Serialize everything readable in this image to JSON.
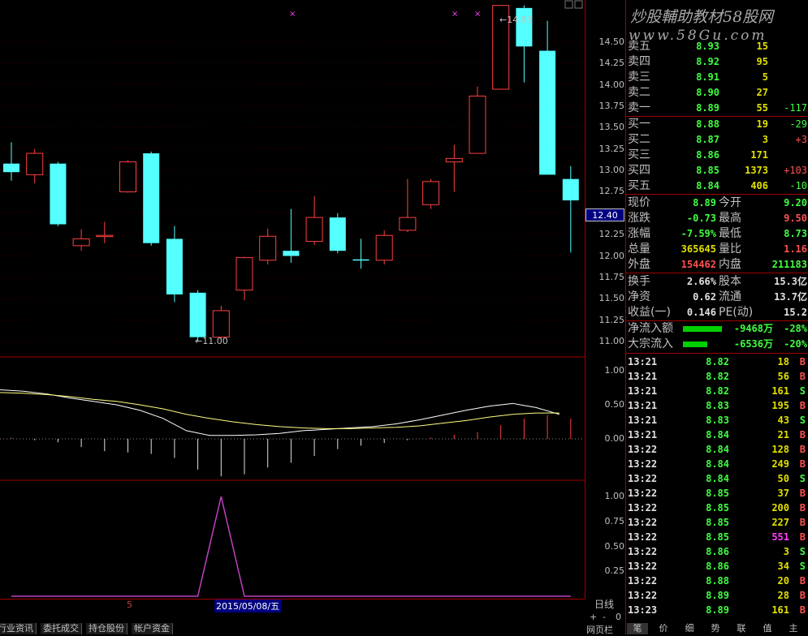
{
  "chart": {
    "price_ticks": [
      "14.50",
      "14.25",
      "14.00",
      "13.75",
      "13.50",
      "13.25",
      "13.00",
      "12.75",
      "12.50",
      "12.25",
      "12.00",
      "11.75",
      "11.50",
      "11.25",
      "11.00"
    ],
    "current_price_marker": "12.40",
    "high_label": "14.93",
    "low_label": "11.00",
    "macd_ticks": [
      "1.00",
      "0.50",
      "0.00"
    ],
    "ind_ticks": [
      "1.00",
      "0.75",
      "0.50",
      "0.25"
    ],
    "date_label": "2015/05/08/五",
    "left_marker": "5",
    "period_label": "日线",
    "candles": [
      {
        "o": 13.08,
        "c": 12.98,
        "h": 13.33,
        "l": 12.88
      },
      {
        "o": 12.95,
        "c": 13.2,
        "h": 13.25,
        "l": 12.85
      },
      {
        "o": 13.08,
        "c": 12.37,
        "h": 13.1,
        "l": 12.35
      },
      {
        "o": 12.12,
        "c": 12.2,
        "h": 12.31,
        "l": 12.06
      },
      {
        "o": 12.24,
        "c": 12.24,
        "h": 12.4,
        "l": 12.15
      },
      {
        "o": 12.75,
        "c": 13.1,
        "h": 13.12,
        "l": 12.74
      },
      {
        "o": 13.2,
        "c": 12.15,
        "h": 13.22,
        "l": 12.12
      },
      {
        "o": 12.2,
        "c": 11.55,
        "h": 12.35,
        "l": 11.46
      },
      {
        "o": 11.57,
        "c": 11.05,
        "h": 11.6,
        "l": 11.0
      },
      {
        "o": 11.05,
        "c": 11.36,
        "h": 11.42,
        "l": 11.03
      },
      {
        "o": 11.6,
        "c": 11.98,
        "h": 11.99,
        "l": 11.48
      },
      {
        "o": 11.95,
        "c": 12.23,
        "h": 12.32,
        "l": 11.9
      },
      {
        "o": 12.06,
        "c": 12.0,
        "h": 12.55,
        "l": 11.92
      },
      {
        "o": 12.17,
        "c": 12.45,
        "h": 12.7,
        "l": 12.13
      },
      {
        "o": 12.45,
        "c": 12.06,
        "h": 12.5,
        "l": 12.03
      },
      {
        "o": 11.96,
        "c": 11.95,
        "h": 12.2,
        "l": 11.85
      },
      {
        "o": 11.95,
        "c": 12.24,
        "h": 12.3,
        "l": 11.9
      },
      {
        "o": 12.3,
        "c": 12.45,
        "h": 12.9,
        "l": 12.28
      },
      {
        "o": 12.6,
        "c": 12.87,
        "h": 12.9,
        "l": 12.55
      },
      {
        "o": 13.1,
        "c": 13.14,
        "h": 13.3,
        "l": 12.75
      },
      {
        "o": 13.2,
        "c": 13.87,
        "h": 13.98,
        "l": 13.2
      },
      {
        "o": 13.95,
        "c": 14.93,
        "h": 14.93,
        "l": 13.95
      },
      {
        "o": 14.9,
        "c": 14.45,
        "h": 14.93,
        "l": 14.03
      },
      {
        "o": 14.4,
        "c": 12.95,
        "h": 14.75,
        "l": 12.95
      },
      {
        "o": 12.9,
        "c": 12.65,
        "h": 13.05,
        "l": 12.04
      }
    ],
    "macd_bars": [
      0.02,
      -0.02,
      -0.05,
      -0.12,
      -0.18,
      -0.2,
      -0.22,
      -0.28,
      -0.45,
      -0.55,
      -0.52,
      -0.42,
      -0.35,
      -0.25,
      -0.15,
      -0.1,
      -0.06,
      -0.02,
      0.02,
      0.06,
      0.1,
      0.2,
      0.3,
      0.35,
      0.3
    ],
    "dif": [
      0.72,
      0.7,
      0.66,
      0.6,
      0.55,
      0.5,
      0.42,
      0.3,
      0.12,
      0.05,
      0.05,
      0.06,
      0.08,
      0.12,
      0.14,
      0.16,
      0.18,
      0.22,
      0.28,
      0.35,
      0.42,
      0.48,
      0.52,
      0.46,
      0.36
    ],
    "dea": [
      0.68,
      0.67,
      0.65,
      0.62,
      0.58,
      0.55,
      0.5,
      0.44,
      0.36,
      0.3,
      0.25,
      0.21,
      0.18,
      0.16,
      0.15,
      0.15,
      0.16,
      0.17,
      0.19,
      0.23,
      0.27,
      0.32,
      0.36,
      0.38,
      0.38
    ],
    "ind_line": [
      0,
      0,
      0,
      0,
      0,
      0,
      0,
      0,
      0,
      1,
      0,
      0,
      0,
      0,
      0,
      0,
      0,
      0,
      0,
      0,
      0,
      0,
      0,
      0,
      0
    ]
  },
  "watermark": {
    "line1": "炒股輔助教材58股网",
    "line2": "www.58Gu.com"
  },
  "sell": [
    {
      "label": "卖五",
      "price": "8.93",
      "vol": "15",
      "chg": ""
    },
    {
      "label": "卖四",
      "price": "8.92",
      "vol": "95",
      "chg": ""
    },
    {
      "label": "卖三",
      "price": "8.91",
      "vol": "5",
      "chg": ""
    },
    {
      "label": "卖二",
      "price": "8.90",
      "vol": "27",
      "chg": ""
    },
    {
      "label": "卖一",
      "price": "8.89",
      "vol": "55",
      "chg": "-117"
    }
  ],
  "buy": [
    {
      "label": "买一",
      "price": "8.88",
      "vol": "19",
      "chg": "-29"
    },
    {
      "label": "买二",
      "price": "8.87",
      "vol": "3",
      "chg": "+3"
    },
    {
      "label": "买三",
      "price": "8.86",
      "vol": "171",
      "chg": ""
    },
    {
      "label": "买四",
      "price": "8.85",
      "vol": "1373",
      "chg": "+103"
    },
    {
      "label": "买五",
      "price": "8.84",
      "vol": "406",
      "chg": "-10"
    }
  ],
  "stats": [
    {
      "l1": "现价",
      "v1": "8.89",
      "l2": "今开",
      "v2": "9.20"
    },
    {
      "l1": "涨跌",
      "v1": "-0.73",
      "l2": "最高",
      "v2": "9.50"
    },
    {
      "l1": "涨幅",
      "v1": "-7.59%",
      "l2": "最低",
      "v2": "8.73"
    },
    {
      "l1": "总量",
      "v1": "365645",
      "l2": "量比",
      "v2": "1.16"
    },
    {
      "l1": "外盘",
      "v1": "154462",
      "l2": "内盘",
      "v2": "211183"
    }
  ],
  "stats2": [
    {
      "l1": "换手",
      "v1": "2.66%",
      "l2": "股本",
      "v2": "15.3亿"
    },
    {
      "l1": "净资",
      "v1": "0.62",
      "l2": "流通",
      "v2": "13.7亿"
    },
    {
      "l1": "收益(一)",
      "v1": "0.146",
      "l2": "PE(动)",
      "v2": "15.2"
    }
  ],
  "flows": [
    {
      "label": "净流入额",
      "value": "-9468万",
      "pct": "-28%"
    },
    {
      "label": "大宗流入",
      "value": "-6536万",
      "pct": "-20%"
    }
  ],
  "ticks": [
    {
      "t": "13:21",
      "p": "8.82",
      "v": "18",
      "s": "B"
    },
    {
      "t": "13:21",
      "p": "8.82",
      "v": "56",
      "s": "B"
    },
    {
      "t": "13:21",
      "p": "8.82",
      "v": "161",
      "s": "S"
    },
    {
      "t": "13:21",
      "p": "8.83",
      "v": "195",
      "s": "B"
    },
    {
      "t": "13:21",
      "p": "8.83",
      "v": "43",
      "s": "S"
    },
    {
      "t": "13:21",
      "p": "8.84",
      "v": "21",
      "s": "B"
    },
    {
      "t": "13:22",
      "p": "8.84",
      "v": "128",
      "s": "B"
    },
    {
      "t": "13:22",
      "p": "8.84",
      "v": "249",
      "s": "B"
    },
    {
      "t": "13:22",
      "p": "8.84",
      "v": "50",
      "s": "S"
    },
    {
      "t": "13:22",
      "p": "8.85",
      "v": "37",
      "s": "B"
    },
    {
      "t": "13:22",
      "p": "8.85",
      "v": "200",
      "s": "B"
    },
    {
      "t": "13:22",
      "p": "8.85",
      "v": "227",
      "s": "B"
    },
    {
      "t": "13:22",
      "p": "8.85",
      "v": "551",
      "s": "B"
    },
    {
      "t": "13:22",
      "p": "8.86",
      "v": "3",
      "s": "S"
    },
    {
      "t": "13:22",
      "p": "8.86",
      "v": "34",
      "s": "S"
    },
    {
      "t": "13:22",
      "p": "8.88",
      "v": "20",
      "s": "B"
    },
    {
      "t": "13:22",
      "p": "8.89",
      "v": "28",
      "s": "B"
    },
    {
      "t": "13:23",
      "p": "8.89",
      "v": "161",
      "s": "B"
    }
  ],
  "bottom_tabs": [
    "行业资讯",
    "委托成交",
    "持仓股份",
    "帐户资金"
  ],
  "zoom": {
    "plus": "+",
    "minus": "-",
    "value": "0"
  },
  "quote_tabs": [
    "笔",
    "价",
    "细",
    "势",
    "联",
    "值",
    "主"
  ],
  "quote_footer": "网页栏"
}
